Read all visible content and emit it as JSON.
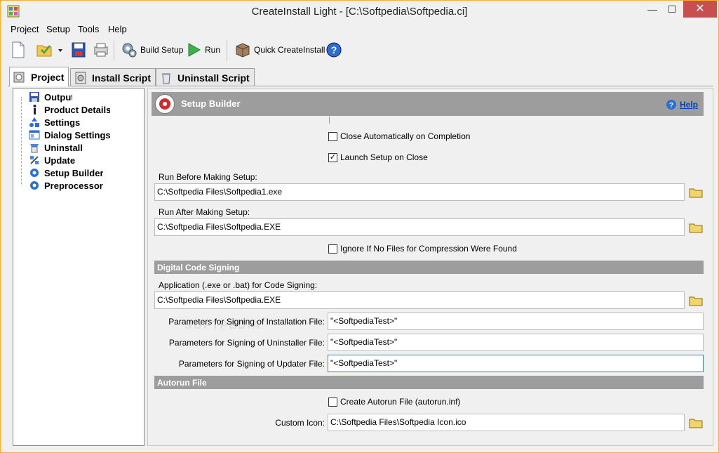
{
  "window": {
    "title": "CreateInstall Light - [C:\\Softpedia\\Softpedia.ci]",
    "minimize_glyph": "—",
    "maximize_glyph": "☐",
    "close_glyph": "✕"
  },
  "menu": [
    "Project",
    "Setup",
    "Tools",
    "Help"
  ],
  "toolbar": {
    "build_setup": "Build Setup",
    "run": "Run",
    "quick_createinstall": "Quick CreateInstall"
  },
  "tabs": [
    "Project",
    "Install Script",
    "Uninstall Script"
  ],
  "tree": [
    {
      "label": "Output",
      "icon": "floppy-icon"
    },
    {
      "label": "Product Details",
      "icon": "info-icon"
    },
    {
      "label": "Settings",
      "icon": "shapes-icon"
    },
    {
      "label": "Dialog Settings",
      "icon": "dialog-icon"
    },
    {
      "label": "Uninstall",
      "icon": "uninstall-icon"
    },
    {
      "label": "Update",
      "icon": "satellite-icon"
    },
    {
      "label": "Setup Builder",
      "icon": "gear-icon"
    },
    {
      "label": "Preprocessor",
      "icon": "gear-icon"
    }
  ],
  "header": {
    "title": "Setup Builder",
    "help": "Help"
  },
  "options": {
    "close_auto": {
      "label": "Close Automatically on Completion",
      "checked": false
    },
    "launch_setup": {
      "label": "Launch Setup on Close",
      "checked": true
    },
    "ignore_no_files": {
      "label": "Ignore If No Files for Compression Were Found",
      "checked": false
    },
    "create_autorun": {
      "label": "Create Autorun File (autorun.inf)",
      "checked": false
    }
  },
  "run_before": {
    "label": "Run Before Making Setup:",
    "value": "C:\\Softpedia Files\\Softpedia1.exe"
  },
  "run_after": {
    "label": "Run After Making Setup:",
    "value": "C:\\Softpedia Files\\Softpedia.EXE"
  },
  "signing": {
    "section": "Digital Code Signing",
    "app_label": "Application (.exe or .bat) for Code Signing:",
    "app_value": "C:\\Softpedia Files\\Softpedia.EXE",
    "install_label": "Parameters for Signing of Installation File:",
    "install_value": "\"<SoftpediaTest>\"",
    "uninstall_label": "Parameters for Signing of Uninstaller File:",
    "uninstall_value": "\"<SoftpediaTest>\"",
    "updater_label": "Parameters for Signing of Updater File:",
    "updater_value": "\"<SoftpediaTest>\""
  },
  "autorun": {
    "section": "Autorun File",
    "icon_label": "Custom Icon:",
    "icon_value": "C:\\Softpedia Files\\Softpedia Icon.ico"
  },
  "watermark": "SOFTPEDIA",
  "check_glyph": "✓"
}
